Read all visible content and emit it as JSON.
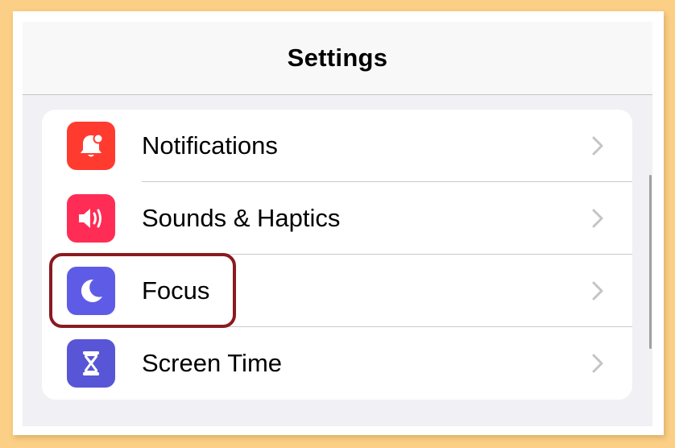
{
  "navbar": {
    "title": "Settings"
  },
  "settings": {
    "items": [
      {
        "label": "Notifications",
        "icon": "bell-badge-icon",
        "color": "#ff3b30"
      },
      {
        "label": "Sounds & Haptics",
        "icon": "speaker-wave-icon",
        "color": "#ff2d55"
      },
      {
        "label": "Focus",
        "icon": "moon-icon",
        "color": "#5e5ce6"
      },
      {
        "label": "Screen Time",
        "icon": "hourglass-icon",
        "color": "#5856d6"
      }
    ]
  },
  "highlight": {
    "target": "Focus",
    "color": "#8b1a1f"
  }
}
